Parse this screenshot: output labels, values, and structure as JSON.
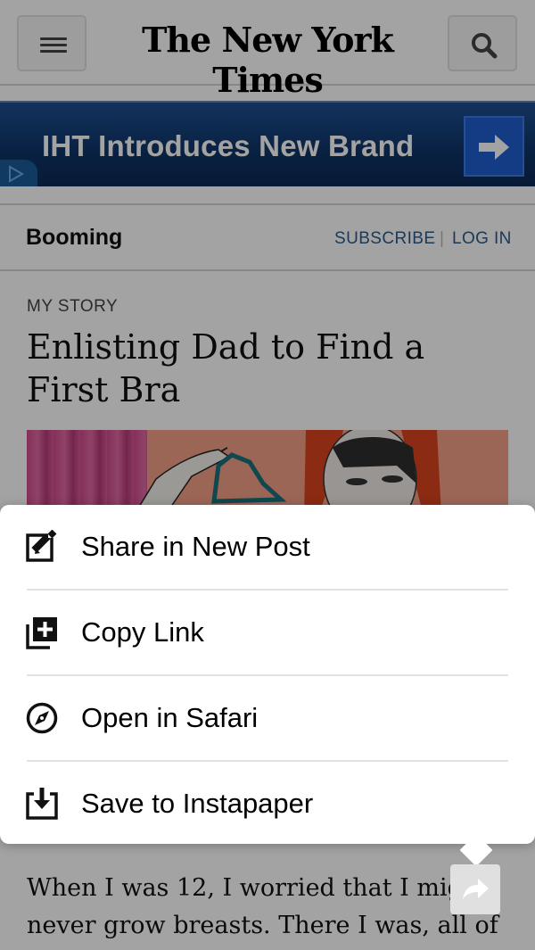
{
  "masthead": {
    "logo": "The New York Times",
    "menu_icon": "hamburger-menu-icon",
    "search_icon": "search-icon"
  },
  "banner": {
    "text": "IHT Introduces New Brand",
    "arrow_icon": "arrow-right-icon",
    "adchoices_icon": "adchoices-icon"
  },
  "section": {
    "name": "Booming",
    "subscribe": "SUBSCRIBE",
    "separator": "|",
    "login": "LOG IN"
  },
  "article": {
    "kicker": "MY STORY",
    "headline": "Enlisting Dad to Find a First Bra",
    "body": "When I was 12, I worried that I might never grow breasts. There I was, all of"
  },
  "share_menu": {
    "items": [
      {
        "label": "Share in New Post",
        "icon": "compose-icon"
      },
      {
        "label": "Copy Link",
        "icon": "copy-link-icon"
      },
      {
        "label": "Open in Safari",
        "icon": "compass-icon"
      },
      {
        "label": "Save to Instapaper",
        "icon": "save-download-icon"
      }
    ]
  },
  "share_button": {
    "icon": "share-arrow-icon"
  },
  "colors": {
    "banner_bg": "#0f3467",
    "link_blue": "#2e5a8a",
    "overlay": "rgba(0,0,0,0.36)"
  }
}
